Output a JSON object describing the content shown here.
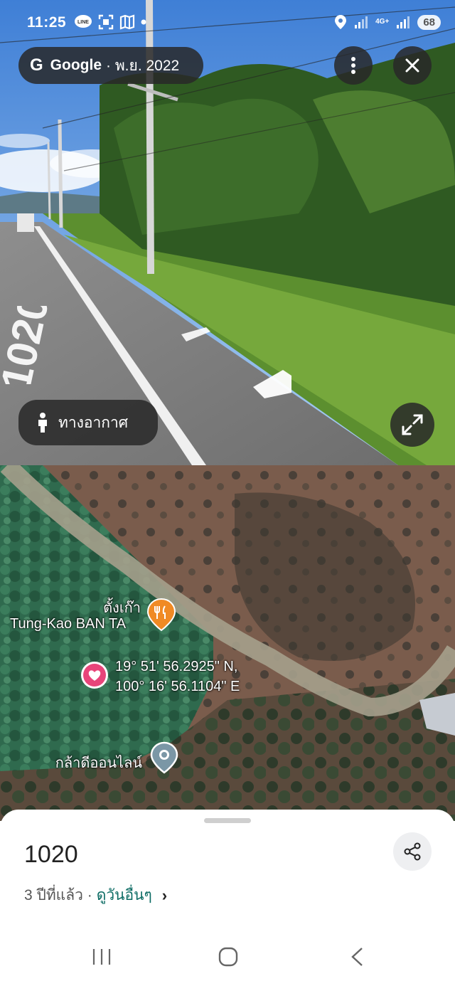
{
  "status_bar": {
    "time": "11:25",
    "line_badge": "LINE",
    "network_label": "4G+",
    "battery": "68"
  },
  "street_view": {
    "brand_letter": "G",
    "brand": "Google",
    "date": "· พ.ย. 2022",
    "more_icon": "more-vert-icon",
    "close_icon": "close-icon",
    "aerial_label": "ทางอากาศ",
    "expand_icon": "expand-icon",
    "road_marking": "1020"
  },
  "map": {
    "place1_thai": "ตั้งเก๊า",
    "place1_english": "Tung-Kao BAN TA",
    "coord_lat": "19° 51' 56.2925\" N,",
    "coord_lng": "100° 16' 56.1104\" E",
    "place2": "กล้าดีออนไลน์",
    "colors": {
      "restaurant_pin": "#f08a24",
      "dropped_pin": "#e8457a",
      "place_pin": "#6e8c9a"
    }
  },
  "sheet": {
    "title": "1020",
    "age": "3 ปีที่แล้ว ·",
    "see_more": "ดูวันอื่นๆ",
    "chevron": "›",
    "share_icon": "share-icon"
  },
  "navbar": {
    "recent_icon": "recent-apps-icon",
    "home_icon": "home-icon",
    "back_icon": "back-icon"
  }
}
